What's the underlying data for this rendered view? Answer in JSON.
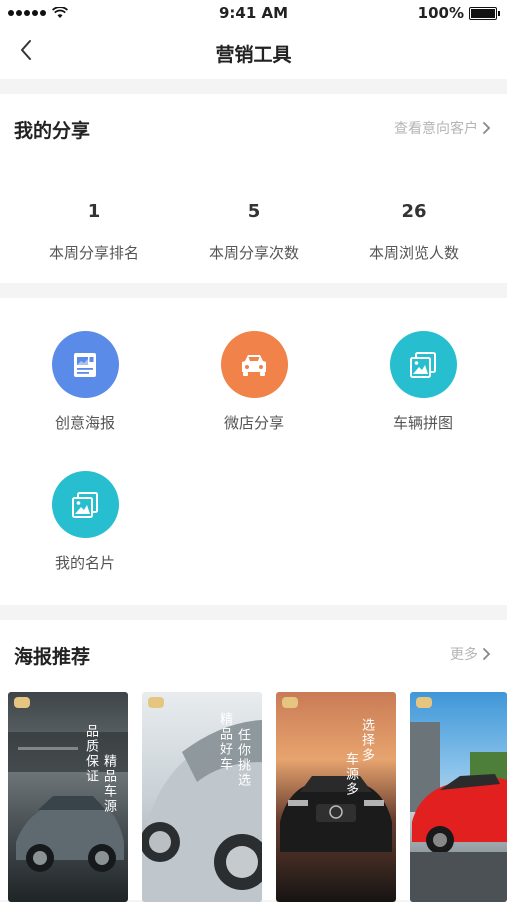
{
  "status_bar": {
    "time": "9:41 AM",
    "battery": "100%"
  },
  "nav": {
    "title": "营销工具"
  },
  "my_share": {
    "title": "我的分享",
    "link": "查看意向客户",
    "stats": [
      {
        "value": "1",
        "label": "本周分享排名"
      },
      {
        "value": "5",
        "label": "本周分享次数"
      },
      {
        "value": "26",
        "label": "本周浏览人数"
      }
    ]
  },
  "tools": [
    {
      "label": "创意海报",
      "icon": "poster-icon",
      "color": "#5b8be8"
    },
    {
      "label": "微店分享",
      "icon": "car-icon",
      "color": "#f0824a"
    },
    {
      "label": "车辆拼图",
      "icon": "image-collage-icon",
      "color": "#27bfd0"
    },
    {
      "label": "我的名片",
      "icon": "business-card-icon",
      "color": "#27bfd0"
    }
  ],
  "poster_section": {
    "title": "海报推荐",
    "more": "更多",
    "posters": [
      {
        "text": [
          "品质保证",
          "精品车源"
        ]
      },
      {
        "text": [
          "精品好车",
          "任你挑选"
        ]
      },
      {
        "text": [
          "选择多",
          "车源多"
        ]
      },
      {
        "text": []
      }
    ]
  }
}
